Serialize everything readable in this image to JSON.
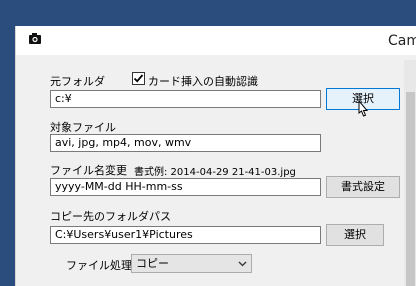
{
  "window": {
    "title": "Cam"
  },
  "source": {
    "label": "元フォルダ",
    "auto_detect_label": "カード挿入の自動認識",
    "auto_detect_checked": true,
    "path_value": "c:¥",
    "select_label": "選択"
  },
  "target": {
    "label": "対象ファイル",
    "extensions_value": "avi, jpg, mp4, mov, wmv"
  },
  "rename": {
    "label": "ファイル名変更",
    "example_text": "書式例: 2014-04-29 21-41-03.jpg",
    "format_value": "yyyy-MM-dd HH-mm-ss",
    "format_settings_label": "書式設定"
  },
  "copy": {
    "label": "コピー先のフォルダパス",
    "path_value": "C:¥Users¥user1¥Pictures",
    "select_label": "選択"
  },
  "processing": {
    "label": "ファイル処理",
    "selected": "コピー"
  }
}
